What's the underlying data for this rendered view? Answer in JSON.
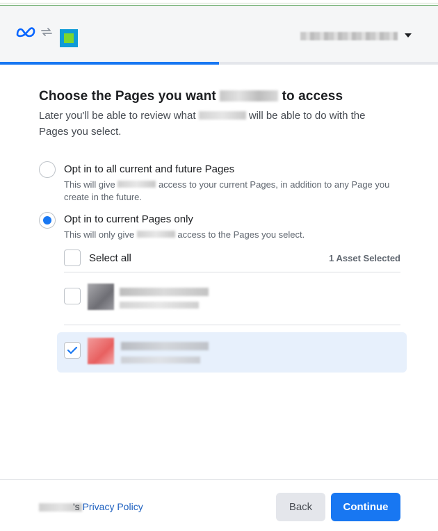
{
  "header": {
    "account_name_redacted": "",
    "progress": 0.5
  },
  "main": {
    "title_before": "Choose the Pages you want",
    "title_after": "to access",
    "subtitle_before": "Later you'll be able to review what",
    "subtitle_after": "will be able to do with the Pages you select."
  },
  "options": [
    {
      "label": "Opt in to all current and future Pages",
      "desc_before": "This will give",
      "desc_after": "access to your current Pages, in addition to any Page you create in the future.",
      "selected": false
    },
    {
      "label": "Opt in to current Pages only",
      "desc_before": "This will only give",
      "desc_after": "access to the Pages you select.",
      "selected": true
    }
  ],
  "pages": {
    "select_all_label": "Select all",
    "selected_count": "1 Asset Selected",
    "items": [
      {
        "checked": false,
        "thumb_color": "#8a8a8f"
      },
      {
        "checked": true,
        "thumb_color": "#ef7b7b"
      }
    ]
  },
  "footer": {
    "policy_suffix": "'s ",
    "policy_link": "Privacy Policy",
    "back_label": "Back",
    "continue_label": "Continue"
  },
  "colors": {
    "accent": "#1877f2",
    "highlight": "#e7f0fc"
  }
}
